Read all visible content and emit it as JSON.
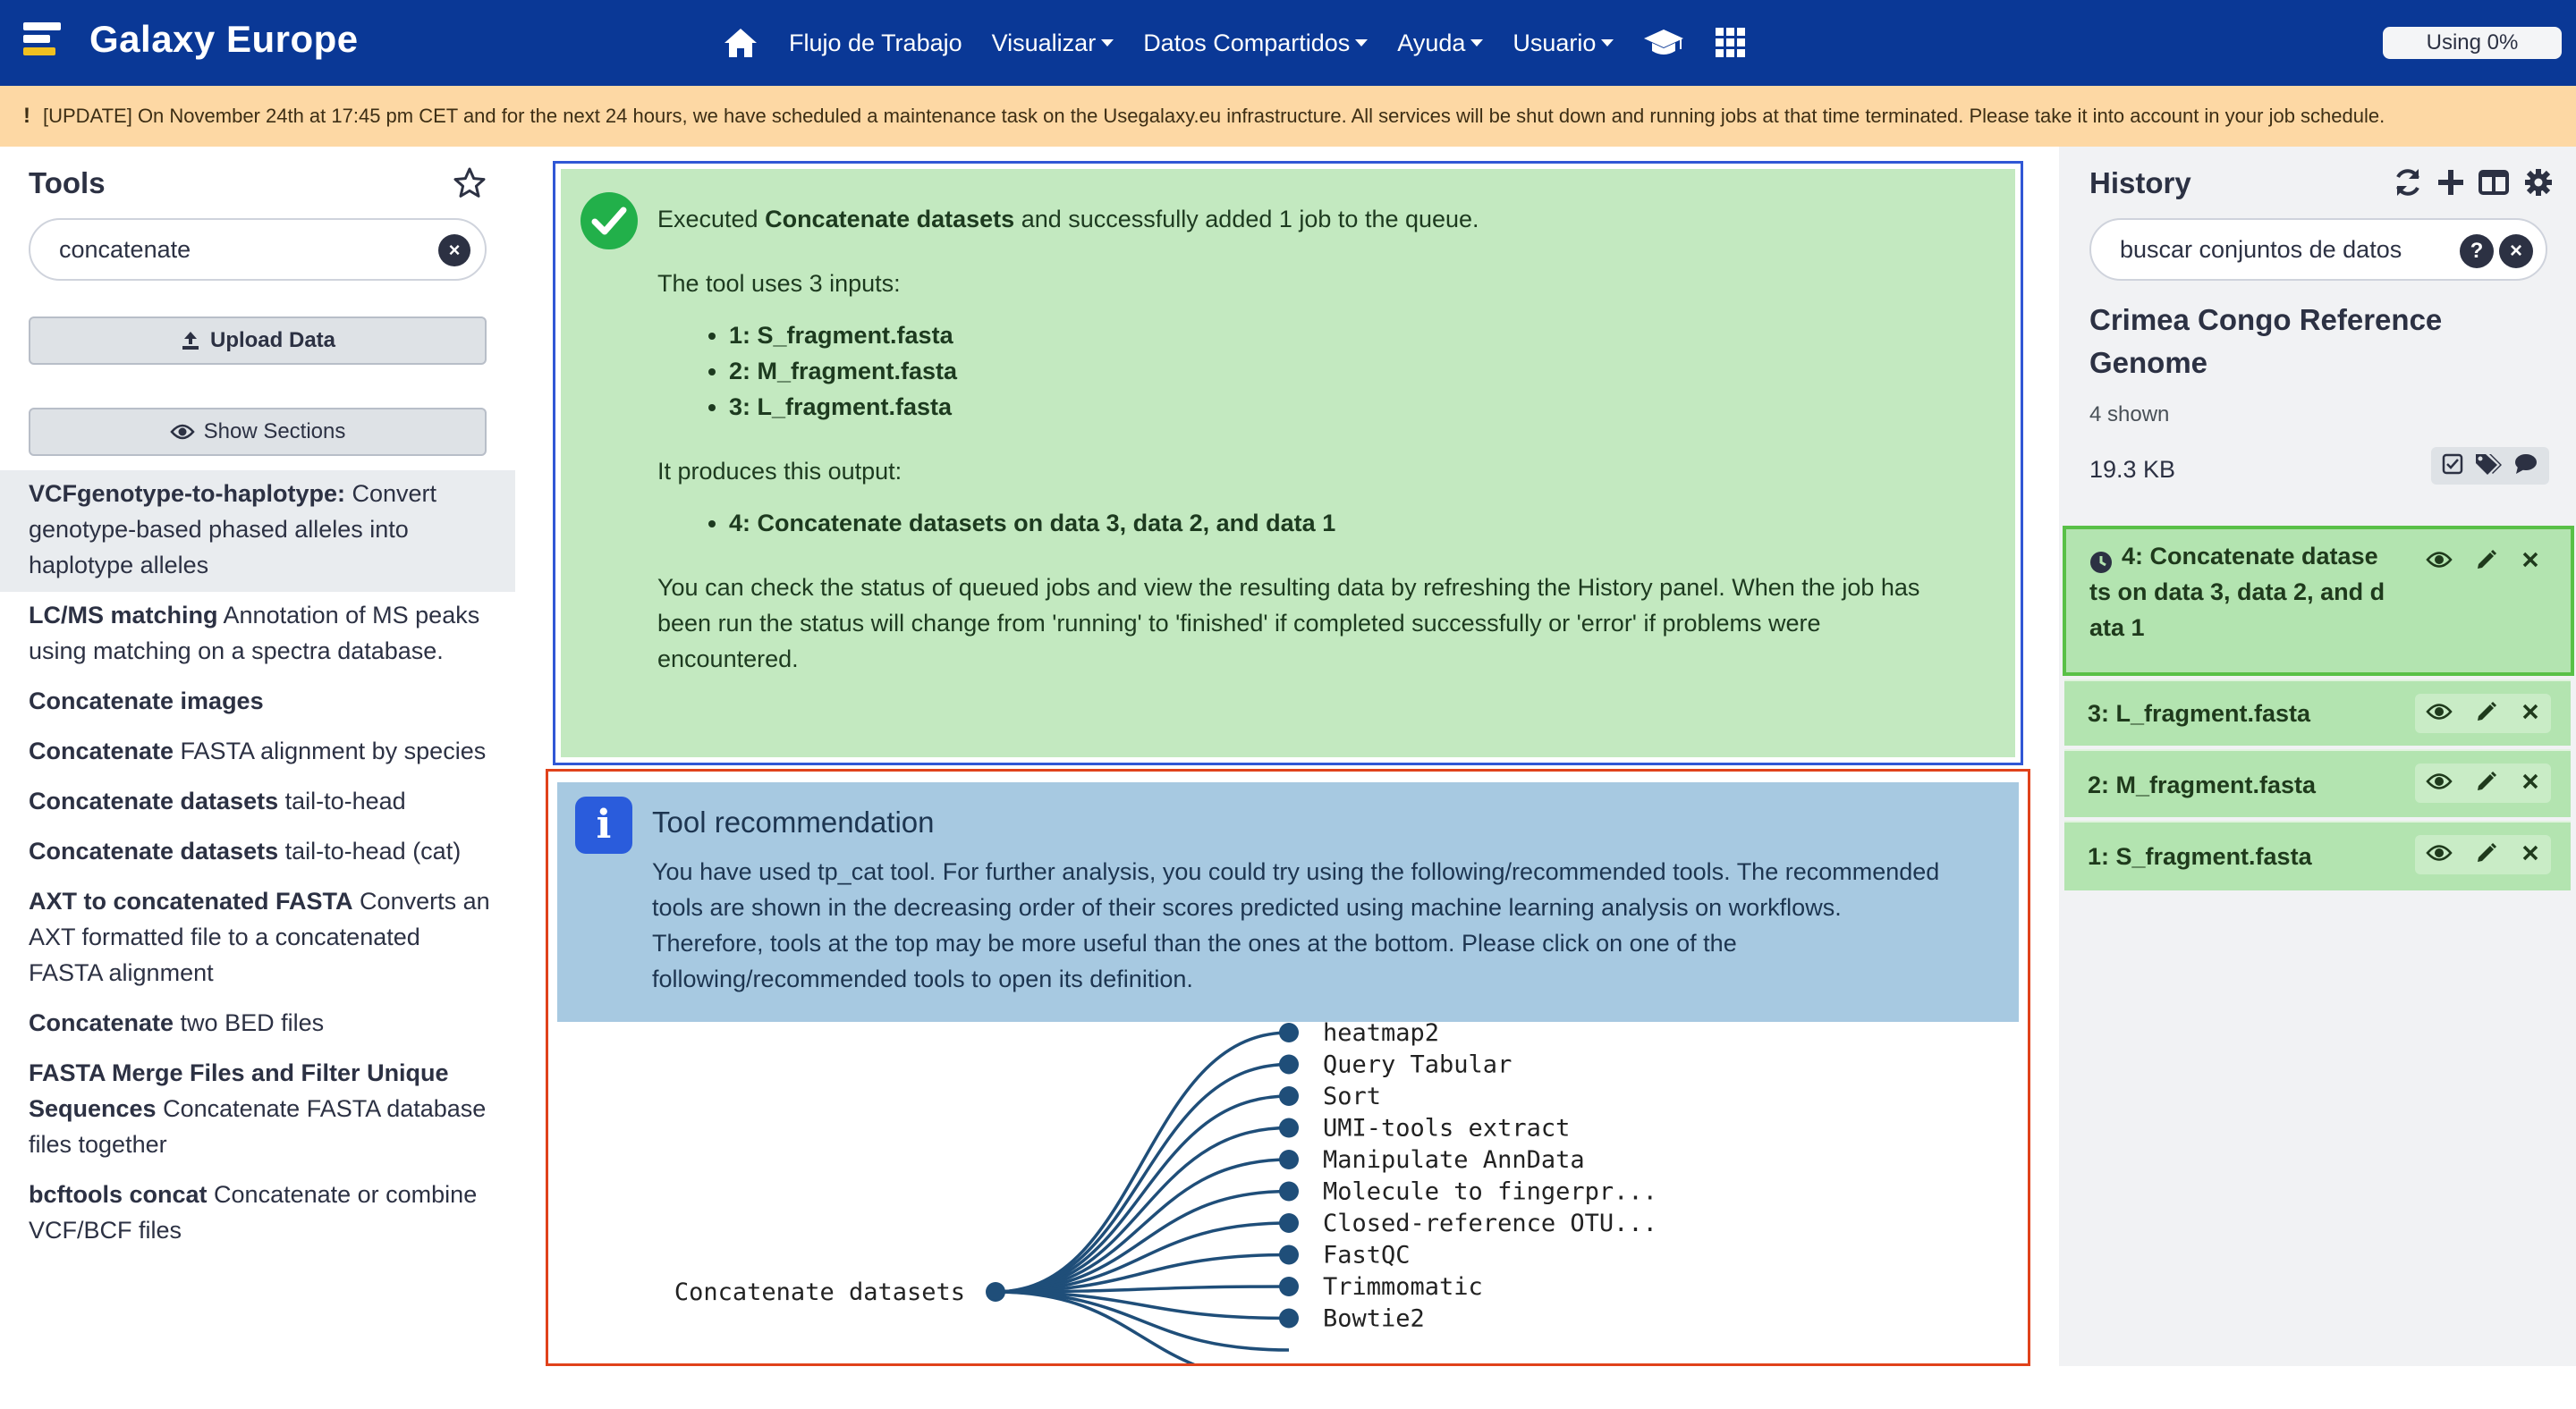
{
  "navbar": {
    "brand": "Galaxy Europe",
    "items": [
      {
        "label": "Flujo de Trabajo",
        "caret": false
      },
      {
        "label": "Visualizar",
        "caret": true
      },
      {
        "label": "Datos Compartidos",
        "caret": true
      },
      {
        "label": "Ayuda",
        "caret": true
      },
      {
        "label": "Usuario",
        "caret": true
      }
    ],
    "quota": "Using 0%"
  },
  "alert": {
    "icon": "!",
    "text": "[UPDATE] On November 24th at 17:45 pm CET and for the next 24 hours, we have scheduled a maintenance task on the Usegalaxy.eu infrastructure. All services will be shut down and running jobs at that time terminated. Please take it into account in your job schedule."
  },
  "tools": {
    "title": "Tools",
    "search_value": "concatenate",
    "upload_label": "Upload Data",
    "sections_label": "Show Sections",
    "items": [
      {
        "name": "VCFgenotype-to-haplotype:",
        "desc": " Convert genotype-based phased alleles into haplotype alleles"
      },
      {
        "name": "LC/MS matching",
        "desc": " Annotation of MS peaks using matching on a spectra database."
      },
      {
        "name": "Concatenate images",
        "desc": ""
      },
      {
        "name": "Concatenate",
        "desc": " FASTA alignment by species"
      },
      {
        "name": "Concatenate datasets",
        "desc": " tail-to-head"
      },
      {
        "name": "Concatenate datasets",
        "desc": " tail-to-head (cat)"
      },
      {
        "name": "AXT to concatenated FASTA",
        "desc": " Converts an AXT formatted file to a concatenated FASTA alignment"
      },
      {
        "name": "Concatenate",
        "desc": " two BED files"
      },
      {
        "name": "FASTA Merge Files and Filter Unique Sequences",
        "desc": " Concatenate FASTA database files together"
      },
      {
        "name": "bcftools concat",
        "desc": " Concatenate or combine VCF/BCF files"
      }
    ]
  },
  "success": {
    "pre": "Executed ",
    "tool": "Concatenate datasets",
    "post": " and successfully added 1 job to the queue.",
    "inputs_text": "The tool uses 3 inputs:",
    "inputs": [
      "1: S_fragment.fasta",
      "2: M_fragment.fasta",
      "3: L_fragment.fasta"
    ],
    "output_text": "It produces this output:",
    "outputs": [
      "4: Concatenate datasets on data 3, data 2, and data 1"
    ],
    "status_text": "You can check the status of queued jobs and view the resulting data by refreshing the History panel. When the job has been run the status will change from 'running' to 'finished' if completed successfully or 'error' if problems were encountered."
  },
  "recommendation": {
    "icon": "i",
    "title": "Tool recommendation",
    "text": "You have used tp_cat tool. For further analysis, you could try using the following/recommended tools. The recommended tools are shown in the decreasing order of their scores predicted using machine learning analysis on workflows. Therefore, tools at the top may be more useful than the ones at the bottom. Please click on one of the following/recommended tools to open its definition.",
    "root": "Concatenate datasets",
    "tools": [
      "heatmap2",
      "Query Tabular",
      "Sort",
      "UMI-tools extract",
      "Manipulate AnnData",
      "Molecule to fingerpr...",
      "Closed-reference OTU...",
      "FastQC",
      "Trimmomatic",
      "Bowtie2"
    ]
  },
  "history": {
    "title": "History",
    "search_placeholder": "buscar conjuntos de datos",
    "name": "Crimea Congo Reference Genome",
    "shown": "4 shown",
    "size": "19.3 KB",
    "datasets": [
      {
        "title": "4: Concatenate datasets on data 3, data 2, and data 1",
        "display": [
          "4: Concatenate datase",
          "ts on data 3, data 2, and d",
          "ata 1"
        ],
        "state": "queued"
      },
      {
        "title": "3: L_fragment.fasta",
        "display": [
          "3: L_fragment.fasta"
        ],
        "state": "ok"
      },
      {
        "title": "2: M_fragment.fasta",
        "display": [
          "2: M_fragment.fasta"
        ],
        "state": "ok"
      },
      {
        "title": "1: S_fragment.fasta",
        "display": [
          "1: S_fragment.fasta"
        ],
        "state": "ok"
      }
    ]
  },
  "colors": {
    "navbar": "#0a3896",
    "alert": "#fdd8a4",
    "success_bg": "#c3e9c0",
    "info_bg": "#a7c9e1",
    "dataset_ok": "#b3e4b0",
    "tree": "#1f4e79"
  }
}
